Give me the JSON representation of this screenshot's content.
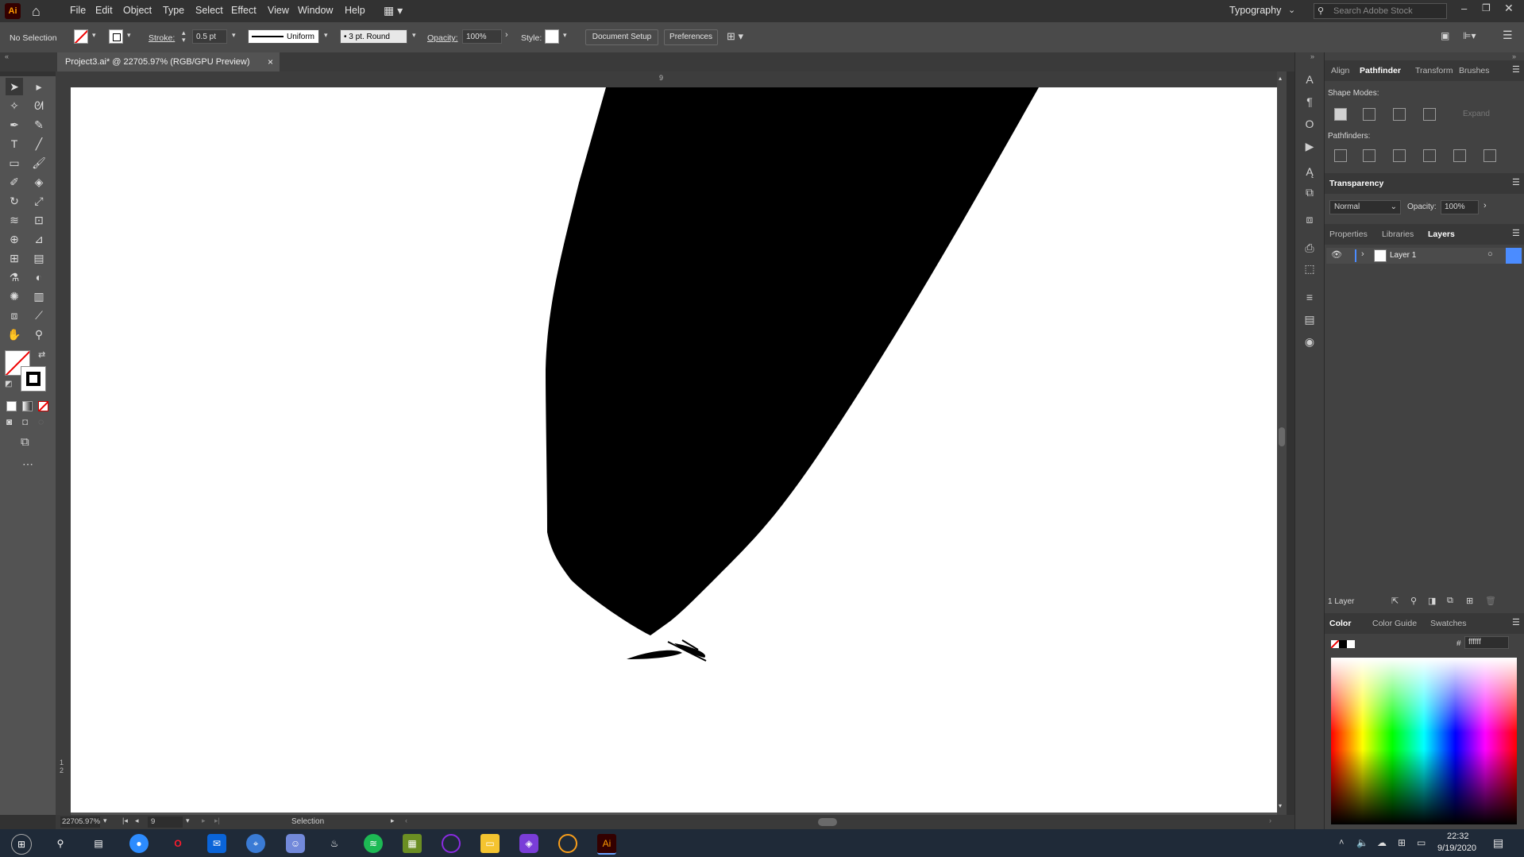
{
  "app": {
    "logo": "Ai"
  },
  "menubar": {
    "items": [
      "File",
      "Edit",
      "Object",
      "Type",
      "Select",
      "Effect",
      "View",
      "Window",
      "Help"
    ],
    "workspace": "Typography",
    "search_placeholder": "Search Adobe Stock"
  },
  "control": {
    "selection": "No Selection",
    "stroke_label": "Stroke:",
    "stroke_value": "0.5 pt",
    "profile": "Uniform",
    "brush": "3 pt. Round",
    "opacity_label": "Opacity:",
    "opacity_value": "100%",
    "style_label": "Style:",
    "doc_setup": "Document Setup",
    "preferences": "Preferences"
  },
  "document": {
    "tab_title": "Project3.ai* @ 22705.97% (RGB/GPU Preview)",
    "close": "×",
    "ruler_top_mark": "9",
    "ruler_left_mark": "1 2"
  },
  "status": {
    "zoom": "22705.97%",
    "page": "9",
    "tool": "Selection"
  },
  "panels": {
    "top_tabs": [
      "Align",
      "Pathfinder",
      "Transform",
      "Brushes"
    ],
    "active_top_tab": "Pathfinder",
    "shape_modes_label": "Shape Modes:",
    "expand_label": "Expand",
    "pathfinders_label": "Pathfinders:",
    "transparency": {
      "title": "Transparency",
      "blend": "Normal",
      "opacity_label": "Opacity:",
      "opacity_value": "100%"
    },
    "mid_tabs": [
      "Properties",
      "Libraries",
      "Layers"
    ],
    "active_mid_tab": "Layers",
    "layer_name": "Layer 1",
    "layers_count": "1 Layer",
    "color_tabs": [
      "Color",
      "Color Guide",
      "Swatches"
    ],
    "active_color_tab": "Color",
    "hex_label": "#",
    "hex_value": "ffffff"
  },
  "taskbar": {
    "time": "22:32",
    "date": "9/19/2020",
    "icons": [
      "windows-start-icon",
      "search-icon",
      "task-view-icon",
      "zoom-icon",
      "opera-icon",
      "mail-icon",
      "safari-icon",
      "discord-icon",
      "steam-icon",
      "spotify-icon",
      "minecraft-icon",
      "tor-icon",
      "file-explorer-icon",
      "app-icon",
      "overwatch-icon",
      "illustrator-icon"
    ]
  },
  "colors": {
    "accent": "#4b8cff",
    "ai_orange": "#ff9a00",
    "panel_bg": "#424242",
    "artboard": "#ffffff"
  }
}
